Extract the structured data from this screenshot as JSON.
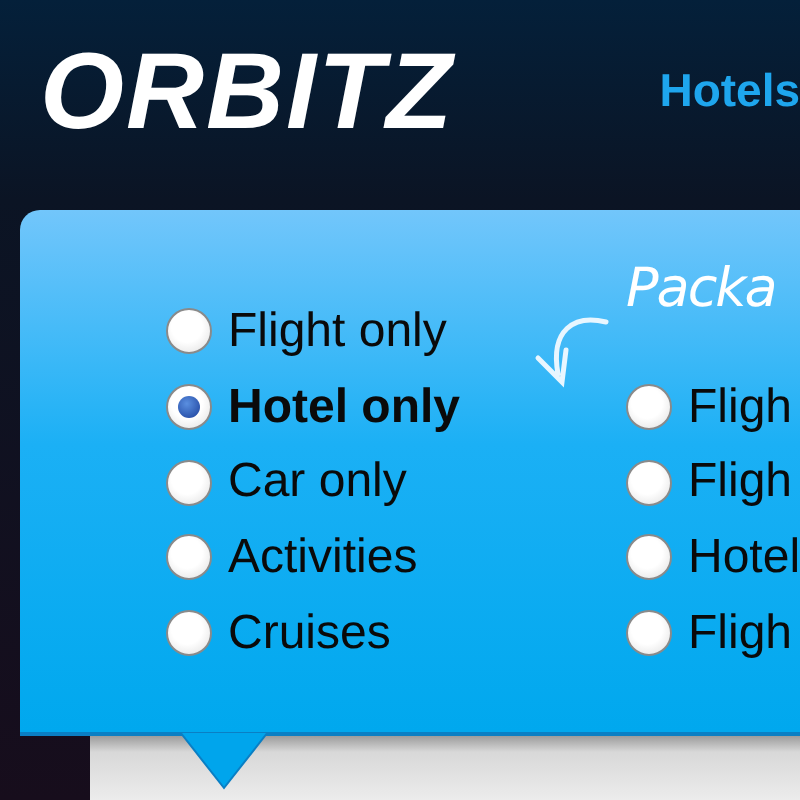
{
  "logo": "ORBITZ",
  "nav": [
    {
      "label": "Hotels"
    }
  ],
  "trip_types": [
    {
      "label": "Flight only",
      "selected": false
    },
    {
      "label": "Hotel only",
      "selected": true
    },
    {
      "label": "Car only",
      "selected": false
    },
    {
      "label": "Activities",
      "selected": false
    },
    {
      "label": "Cruises",
      "selected": false
    }
  ],
  "packages": {
    "title": "Packa",
    "options": [
      {
        "label": "Fligh",
        "selected": false
      },
      {
        "label": "Fligh",
        "selected": false
      },
      {
        "label": "Hotel",
        "selected": false
      },
      {
        "label": "Fligh",
        "selected": false
      }
    ]
  }
}
